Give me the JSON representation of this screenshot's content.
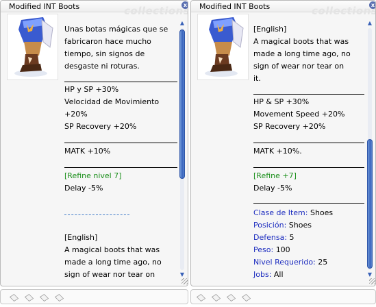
{
  "left_window": {
    "title": "Modified INT Boots",
    "watermark": "collections",
    "close_label": "x",
    "image": {
      "icon": "boots-item-icon",
      "colors": {
        "boot_blue": "#3a5bd0",
        "boot_light": "#7fa0ff",
        "boot_white": "#e8e8f4",
        "sole_brown": "#6b3a20"
      }
    },
    "description_lines": [
      "Unas botas mágicas que se",
      "fabricaron hace mucho",
      "tiempo, sin signos de",
      "desgaste ni roturas."
    ],
    "stats_lines": [
      "HP y SP +30%",
      "Velocidad de Movimiento",
      "+20%",
      "SP Recovery +20%"
    ],
    "matk_line": "MATK +10%",
    "refine_line": "[Refine nivel 7]",
    "delay_line": "Delay -5%",
    "english_header": "[English]",
    "english_lines": [
      "A magical boots that was",
      "made a long time ago, no",
      "sign of wear nor tear on"
    ]
  },
  "right_window": {
    "title": "Modified INT Boots",
    "watermark": "collections",
    "close_label": "x",
    "image": {
      "icon": "boots-item-icon"
    },
    "description_lines": [
      "[English]",
      "A magical boots that was",
      "made a long time ago, no",
      "sign of wear nor tear on",
      "it."
    ],
    "stats_lines": [
      "HP & SP +30%",
      "Movement Speed +20%",
      "SP Recovery +20%"
    ],
    "matk_line": "MATK +10%.",
    "refine_line": "[Refine +7]",
    "delay_line": "Delay -5%",
    "info": [
      {
        "label": "Clase de Item",
        "sep": ": ",
        "value": "Shoes"
      },
      {
        "label": "Posición",
        "sep": ": ",
        "value": "Shoes"
      },
      {
        "label": "Defensa",
        "sep": ": ",
        "value": "5"
      },
      {
        "label": "Peso",
        "sep": ": ",
        "value": "100"
      },
      {
        "label": "Nivel Requerido",
        "sep": ": ",
        "value": "25"
      },
      {
        "label": "Jobs",
        "sep": ": ",
        "value": "All"
      }
    ]
  },
  "slot_bars": {
    "left_slots": 4,
    "right_slots": 4
  },
  "colors": {
    "label_blue": "#1c2cbf",
    "refine_green": "#1a8f1a",
    "scroll_blue": "#3a66bf"
  }
}
